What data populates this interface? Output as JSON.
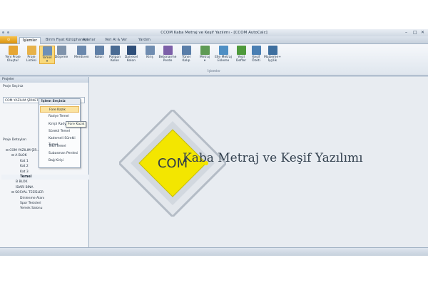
{
  "window": {
    "title": "CCOM Kaba Metraj ve Keşif Yazılımı - [CCOM AutoCalc]",
    "controls": [
      "–",
      "□",
      "✕"
    ]
  },
  "app_button": {
    "label": "⊙"
  },
  "tabs": [
    {
      "label": "İşlemler",
      "active": true
    },
    {
      "label": "Birim Fiyat Kütüphanesi",
      "active": false
    },
    {
      "label": "Ayarlar",
      "active": false
    },
    {
      "label": "Veri Al & Ver",
      "active": false
    },
    {
      "label": "Yardım",
      "active": false
    }
  ],
  "ribbon": {
    "group_label": "İşlemler",
    "buttons": [
      {
        "label": "Yeni Proje\nOluştur",
        "icon": "folder-new-icon",
        "color": "#e6a634"
      },
      {
        "label": "Proje\nListesi",
        "icon": "folder-open-icon",
        "color": "#e7b24a"
      },
      {
        "label": "Temel\n▾",
        "icon": "foundation-grid-icon",
        "color": "#6d90b7",
        "active": true
      },
      {
        "label": "Döşeme",
        "icon": "slab-icon",
        "color": "#7f93ab"
      },
      {
        "label": "Merdiven",
        "icon": "stairs-icon",
        "color": "#6a88ad"
      },
      {
        "label": "Kolon",
        "icon": "column-icon",
        "color": "#5f7fa6"
      },
      {
        "label": "Poligon\nKolon",
        "icon": "polygon-column-icon",
        "color": "#4a6b93"
      },
      {
        "label": "Dairesel\nKolon",
        "icon": "circle-column-icon",
        "color": "#2f4f7a"
      },
      {
        "label": "Kiriş",
        "icon": "beam-icon",
        "color": "#6f8cb0"
      },
      {
        "label": "Betonarme\nPerde",
        "icon": "shear-wall-icon",
        "color": "#7c5fa8"
      },
      {
        "label": "Tünel\nKalıp",
        "icon": "tunnel-form-icon",
        "color": "#5a7ea9"
      },
      {
        "label": "Metraj\n▾",
        "icon": "metraj-icon",
        "color": "#5e9a54"
      },
      {
        "label": "Elle Metraj\nEkleme",
        "icon": "manual-metraj-icon",
        "color": "#4f8fc4"
      },
      {
        "label": "Yeşil\nDefter",
        "icon": "green-book-icon",
        "color": "#4f9a3c"
      },
      {
        "label": "Keşif\nÖzeti",
        "icon": "estimate-summary-icon",
        "color": "#4a7fb3"
      },
      {
        "label": "Malzeme+\nİşçilik",
        "icon": "material-labor-icon",
        "color": "#3e6f9f"
      }
    ]
  },
  "left_panel": {
    "header": "Projeler",
    "project_select_label": "Proje Seçiniz",
    "project_select_value": "COM YAZILIM ŞİRKET...",
    "details_label": "Proje Detayları",
    "tree": [
      {
        "label": "COM YAZILIM ŞİR...",
        "prefix": "⊟",
        "bold": false,
        "selected": false
      },
      {
        "label": "A BLOK",
        "prefix": "⊟",
        "bold": false,
        "selected": false
      },
      {
        "label": "Kat 1",
        "prefix": "",
        "bold": false,
        "selected": false
      },
      {
        "label": "Kat 2",
        "prefix": "",
        "bold": false,
        "selected": false
      },
      {
        "label": "Kat 3",
        "prefix": "",
        "bold": false,
        "selected": false
      },
      {
        "label": "Temel",
        "prefix": "",
        "bold": true,
        "selected": true
      },
      {
        "label": "B BLOK",
        "prefix": "",
        "bold": false,
        "selected": false
      },
      {
        "label": "İDARİ BİNA",
        "prefix": "",
        "bold": false,
        "selected": false
      },
      {
        "label": "SOSYAL TESİSLER",
        "prefix": "⊟",
        "bold": false,
        "selected": false
      },
      {
        "label": "Dinlenme Alanı",
        "prefix": "",
        "bold": false,
        "selected": false
      },
      {
        "label": "Spor Tesisleri",
        "prefix": "",
        "bold": false,
        "selected": false
      },
      {
        "label": "Yemek Salonu",
        "prefix": "",
        "bold": false,
        "selected": false
      }
    ]
  },
  "logo": {
    "mark": "COM",
    "text": "Kaba Metraj ve Keşif Yazılımı",
    "mark_bg": "#f3e600",
    "frame_color": "#b4bcc6"
  },
  "dropdown": {
    "header": "İşlem Seçiniz",
    "items": [
      {
        "label": "Fore Kazık",
        "highlighted": true
      },
      {
        "label": "Radye Temel",
        "highlighted": false
      },
      {
        "label": "Kirişli Radye",
        "highlighted": false
      },
      {
        "label": "Sürekli Temel",
        "highlighted": false
      },
      {
        "label": "Kademeli Sürekli Temel",
        "highlighted": false
      },
      {
        "label": "Tekil Temel",
        "highlighted": false
      },
      {
        "label": "Subasman Perdesi",
        "highlighted": false
      },
      {
        "label": "Bağ Kirişi",
        "highlighted": false
      }
    ],
    "tooltip": "Fore Kazık"
  }
}
